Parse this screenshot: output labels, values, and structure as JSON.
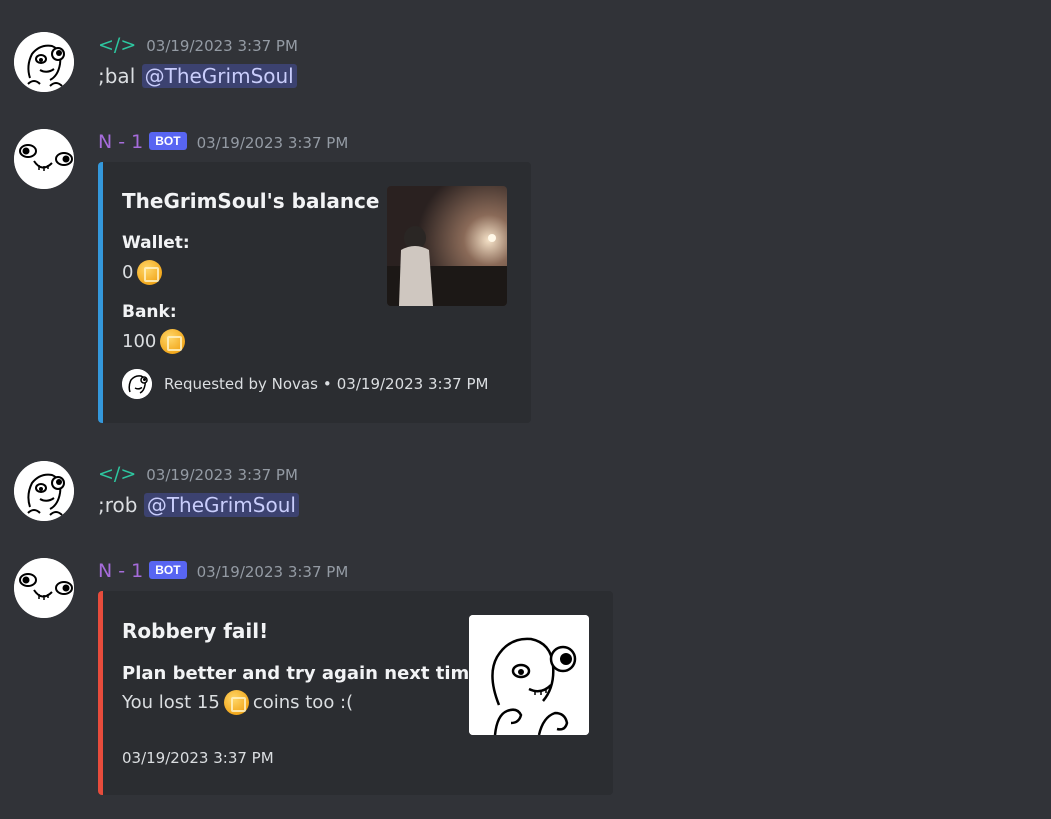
{
  "messages": [
    {
      "author": "</>",
      "author_color": "#2dc7a0",
      "timestamp": "03/19/2023 3:37 PM",
      "command": ";bal",
      "mention": "@TheGrimSoul"
    },
    {
      "author": "N - 1",
      "author_color": "#a66cdb",
      "bot_tag": "BOT",
      "timestamp": "03/19/2023 3:37 PM",
      "embed": {
        "accent": "#3498db",
        "title": "TheGrimSoul's balance",
        "fields": [
          {
            "name": "Wallet:",
            "value": "0"
          },
          {
            "name": "Bank:",
            "value": "100"
          }
        ],
        "footer_text": "Requested by Novas",
        "footer_sep": "•",
        "footer_time": "03/19/2023 3:37 PM",
        "thumbnail_icon": "night-photo"
      }
    },
    {
      "author": "</>",
      "author_color": "#2dc7a0",
      "timestamp": "03/19/2023 3:37 PM",
      "command": ";rob",
      "mention": "@TheGrimSoul"
    },
    {
      "author": "N - 1",
      "author_color": "#a66cdb",
      "bot_tag": "BOT",
      "timestamp": "03/19/2023 3:37 PM",
      "embed": {
        "accent": "#e74c3c",
        "title": "Robbery fail!",
        "desc_bold": "Plan better and try again next time.",
        "desc_prefix": "You lost 15",
        "desc_suffix": "coins too :(",
        "footer_time": "03/19/2023 3:37 PM",
        "thumbnail_icon": "meme-face-drawing"
      }
    }
  ],
  "icons": {
    "coin": "coin-icon",
    "avatar_user": "meme-face-avatar",
    "avatar_bot": "bot-face-avatar"
  }
}
